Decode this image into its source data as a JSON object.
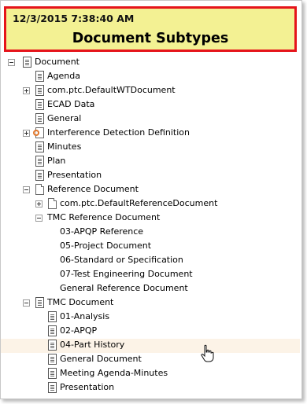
{
  "header": {
    "timestamp": "12/3/2015 7:38:40 AM",
    "title": "Document Subtypes"
  },
  "tree": {
    "items": [
      {
        "label": "Document",
        "expander": "minus",
        "icon": "doc"
      },
      {
        "label": "Agenda",
        "expander": "none",
        "icon": "doc"
      },
      {
        "label": "com.ptc.DefaultWTDocument",
        "expander": "plus",
        "icon": "doc"
      },
      {
        "label": "ECAD Data",
        "expander": "none",
        "icon": "doc"
      },
      {
        "label": "General",
        "expander": "none",
        "icon": "doc"
      },
      {
        "label": "Interference Detection Definition",
        "expander": "plus",
        "icon": "interference"
      },
      {
        "label": "Minutes",
        "expander": "none",
        "icon": "doc"
      },
      {
        "label": "Plan",
        "expander": "none",
        "icon": "doc"
      },
      {
        "label": "Presentation",
        "expander": "none",
        "icon": "doc"
      },
      {
        "label": "Reference Document",
        "expander": "minus",
        "icon": "blank"
      },
      {
        "label": "com.ptc.DefaultReferenceDocument",
        "expander": "plus",
        "icon": "blank"
      },
      {
        "label": "TMC Reference Document",
        "expander": "minus",
        "icon": "none"
      },
      {
        "label": "03-APQP Reference",
        "expander": "none",
        "icon": "none"
      },
      {
        "label": "05-Project Document",
        "expander": "none",
        "icon": "none"
      },
      {
        "label": "06-Standard or Specification",
        "expander": "none",
        "icon": "none"
      },
      {
        "label": "07-Test Engineering Document",
        "expander": "none",
        "icon": "none"
      },
      {
        "label": "General Reference Document",
        "expander": "none",
        "icon": "none"
      },
      {
        "label": "TMC Document",
        "expander": "minus",
        "icon": "doc"
      },
      {
        "label": "01-Analysis",
        "expander": "none",
        "icon": "doc"
      },
      {
        "label": "02-APQP",
        "expander": "none",
        "icon": "doc"
      },
      {
        "label": "04-Part History",
        "expander": "none",
        "icon": "doc",
        "highlighted": true
      },
      {
        "label": "General Document",
        "expander": "none",
        "icon": "doc"
      },
      {
        "label": "Meeting Agenda-Minutes",
        "expander": "none",
        "icon": "doc"
      },
      {
        "label": "Presentation",
        "expander": "none",
        "icon": "doc"
      }
    ]
  },
  "colors": {
    "header_background": "#f3f193",
    "header_border": "#e5141b",
    "highlight_row": "#fcf3e7"
  },
  "cursor": {
    "icon": "hand-pointer-icon"
  }
}
